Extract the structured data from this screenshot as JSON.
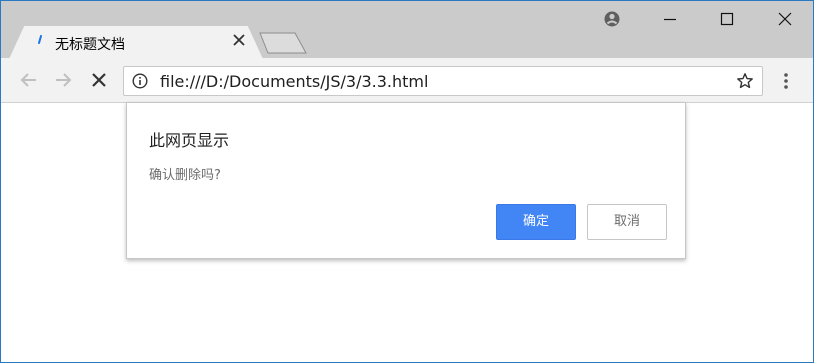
{
  "browser": {
    "tab": {
      "title": "无标题文档"
    },
    "address_bar": {
      "url": "file:///D:/Documents/JS/3/3.3.html"
    }
  },
  "dialog": {
    "title": "此网页显示",
    "message": "确认删除吗?",
    "ok_label": "确定",
    "cancel_label": "取消"
  },
  "colors": {
    "titlebar": "#cbcbcb",
    "toolbar": "#f2f2f2",
    "primary_button": "#4285f4",
    "window_border": "#2b79c2"
  },
  "icons": [
    "loading-icon",
    "close-tab-icon",
    "new-tab-icon",
    "profile-icon",
    "minimize-icon",
    "maximize-icon",
    "close-window-icon",
    "back-icon",
    "forward-icon",
    "stop-icon",
    "info-icon",
    "star-icon",
    "menu-icon"
  ]
}
